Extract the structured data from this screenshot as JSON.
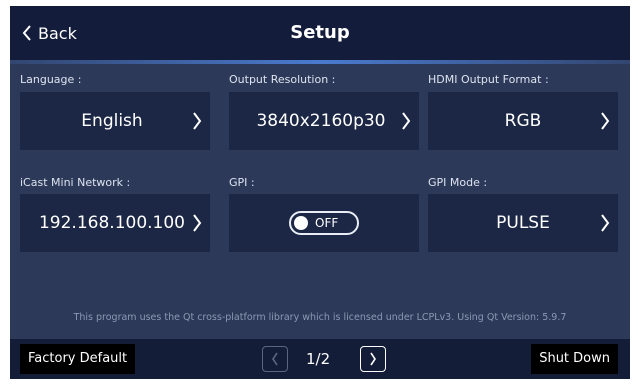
{
  "header": {
    "back_label": "Back",
    "title": "Setup"
  },
  "settings": [
    {
      "label": "Language :",
      "value": "English",
      "has_chevron": true
    },
    {
      "label": "Output Resolution :",
      "value": "3840x2160p30",
      "has_chevron": true
    },
    {
      "label": "HDMI Output Format :",
      "value": "RGB",
      "has_chevron": true
    },
    {
      "label": "iCast Mini  Network :",
      "value": "192.168.100.100",
      "has_chevron": true
    },
    {
      "label": "GPI :",
      "toggle": {
        "state": "OFF",
        "on": false
      }
    },
    {
      "label": "GPI Mode :",
      "value": "PULSE",
      "has_chevron": true
    }
  ],
  "license_text": "This program uses the Qt cross-platform library which is licensed under LCPLv3. Using Qt Version: 5.9.7",
  "footer": {
    "factory_default_label": "Factory Default",
    "page_indicator": "1/2",
    "prev_enabled": false,
    "next_enabled": true,
    "shut_down_label": "Shut Down"
  },
  "colors": {
    "background": "#2c3959",
    "header": "#131c3a",
    "tile": "#1c2745",
    "footer": "#141d37",
    "accent": "#4a7ace"
  }
}
